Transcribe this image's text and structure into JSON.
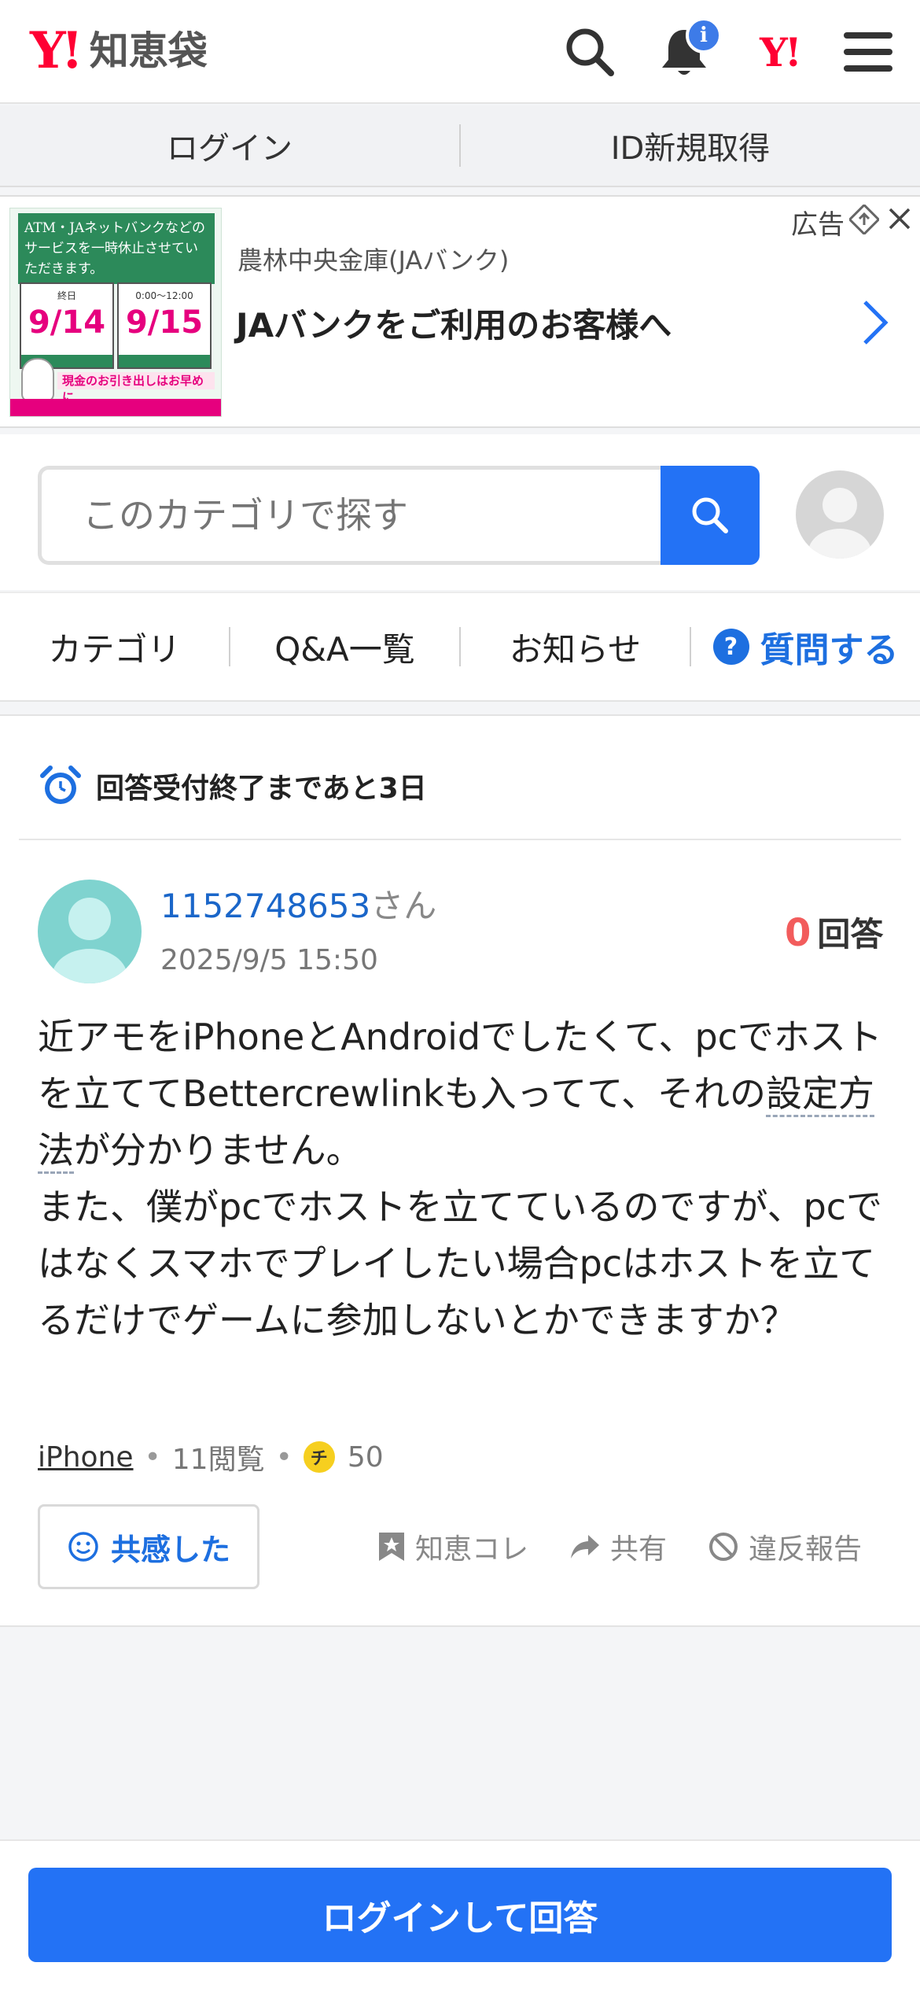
{
  "header": {
    "logo_mark": "Y!",
    "logo_text": "知恵袋",
    "notification_badge": "i",
    "yahoo_mark": "Y!"
  },
  "login_bar": {
    "login": "ログイン",
    "register": "ID新規取得"
  },
  "ad": {
    "label": "広告",
    "advertiser": "農林中央金庫(JAバンク)",
    "title": "JAバンクをご利用のお客様へ",
    "image_text": {
      "notice": "ATM・JAネットバンクなどのサービスを一時休止させていただきます。",
      "date1": "9/14",
      "date1_label": "終日",
      "date2": "9/15",
      "date2_label": "0:00～12:00",
      "cash_notice": "現金のお引き出しはお早めに"
    }
  },
  "search": {
    "placeholder": "このカテゴリで探す"
  },
  "nav": {
    "items": [
      {
        "label": "カテゴリ"
      },
      {
        "label": "Q&A一覧"
      },
      {
        "label": "お知らせ"
      }
    ],
    "ask_label": "質問する",
    "ask_icon": "?"
  },
  "question": {
    "deadline": "回答受付終了まであと3日",
    "user_id": "1152748653",
    "user_suffix": "さん",
    "date": "2025/9/5 15:50",
    "answer_count": "0",
    "answer_label": "回答",
    "body": {
      "p1_a": "近アモをiPhoneとAndroidでしたくて、pcでホストを立ててBettercrewlinkも入ってて、それの",
      "p1_kw": "設定方法",
      "p1_b": "が分かりません。",
      "p2": "また、僕がpcでホストを立てているのですが、pcではなくスマホでプレイしたい場合pcはホストを立てるだけでゲームに参加しないとかできますか？"
    },
    "tag": "iPhone",
    "views": "11閲覧",
    "coin_symbol": "チ",
    "coins": "50",
    "empathy": "共感した",
    "actions": {
      "bookmark": "知恵コレ",
      "share": "共有",
      "report": "違反報告"
    }
  },
  "bottom": {
    "cta": "ログインして回答"
  },
  "colors": {
    "brand_red": "#ff0033",
    "primary_blue": "#2372f5",
    "link_blue": "#1a66c9",
    "answer_count_red": "#f25c5c"
  }
}
